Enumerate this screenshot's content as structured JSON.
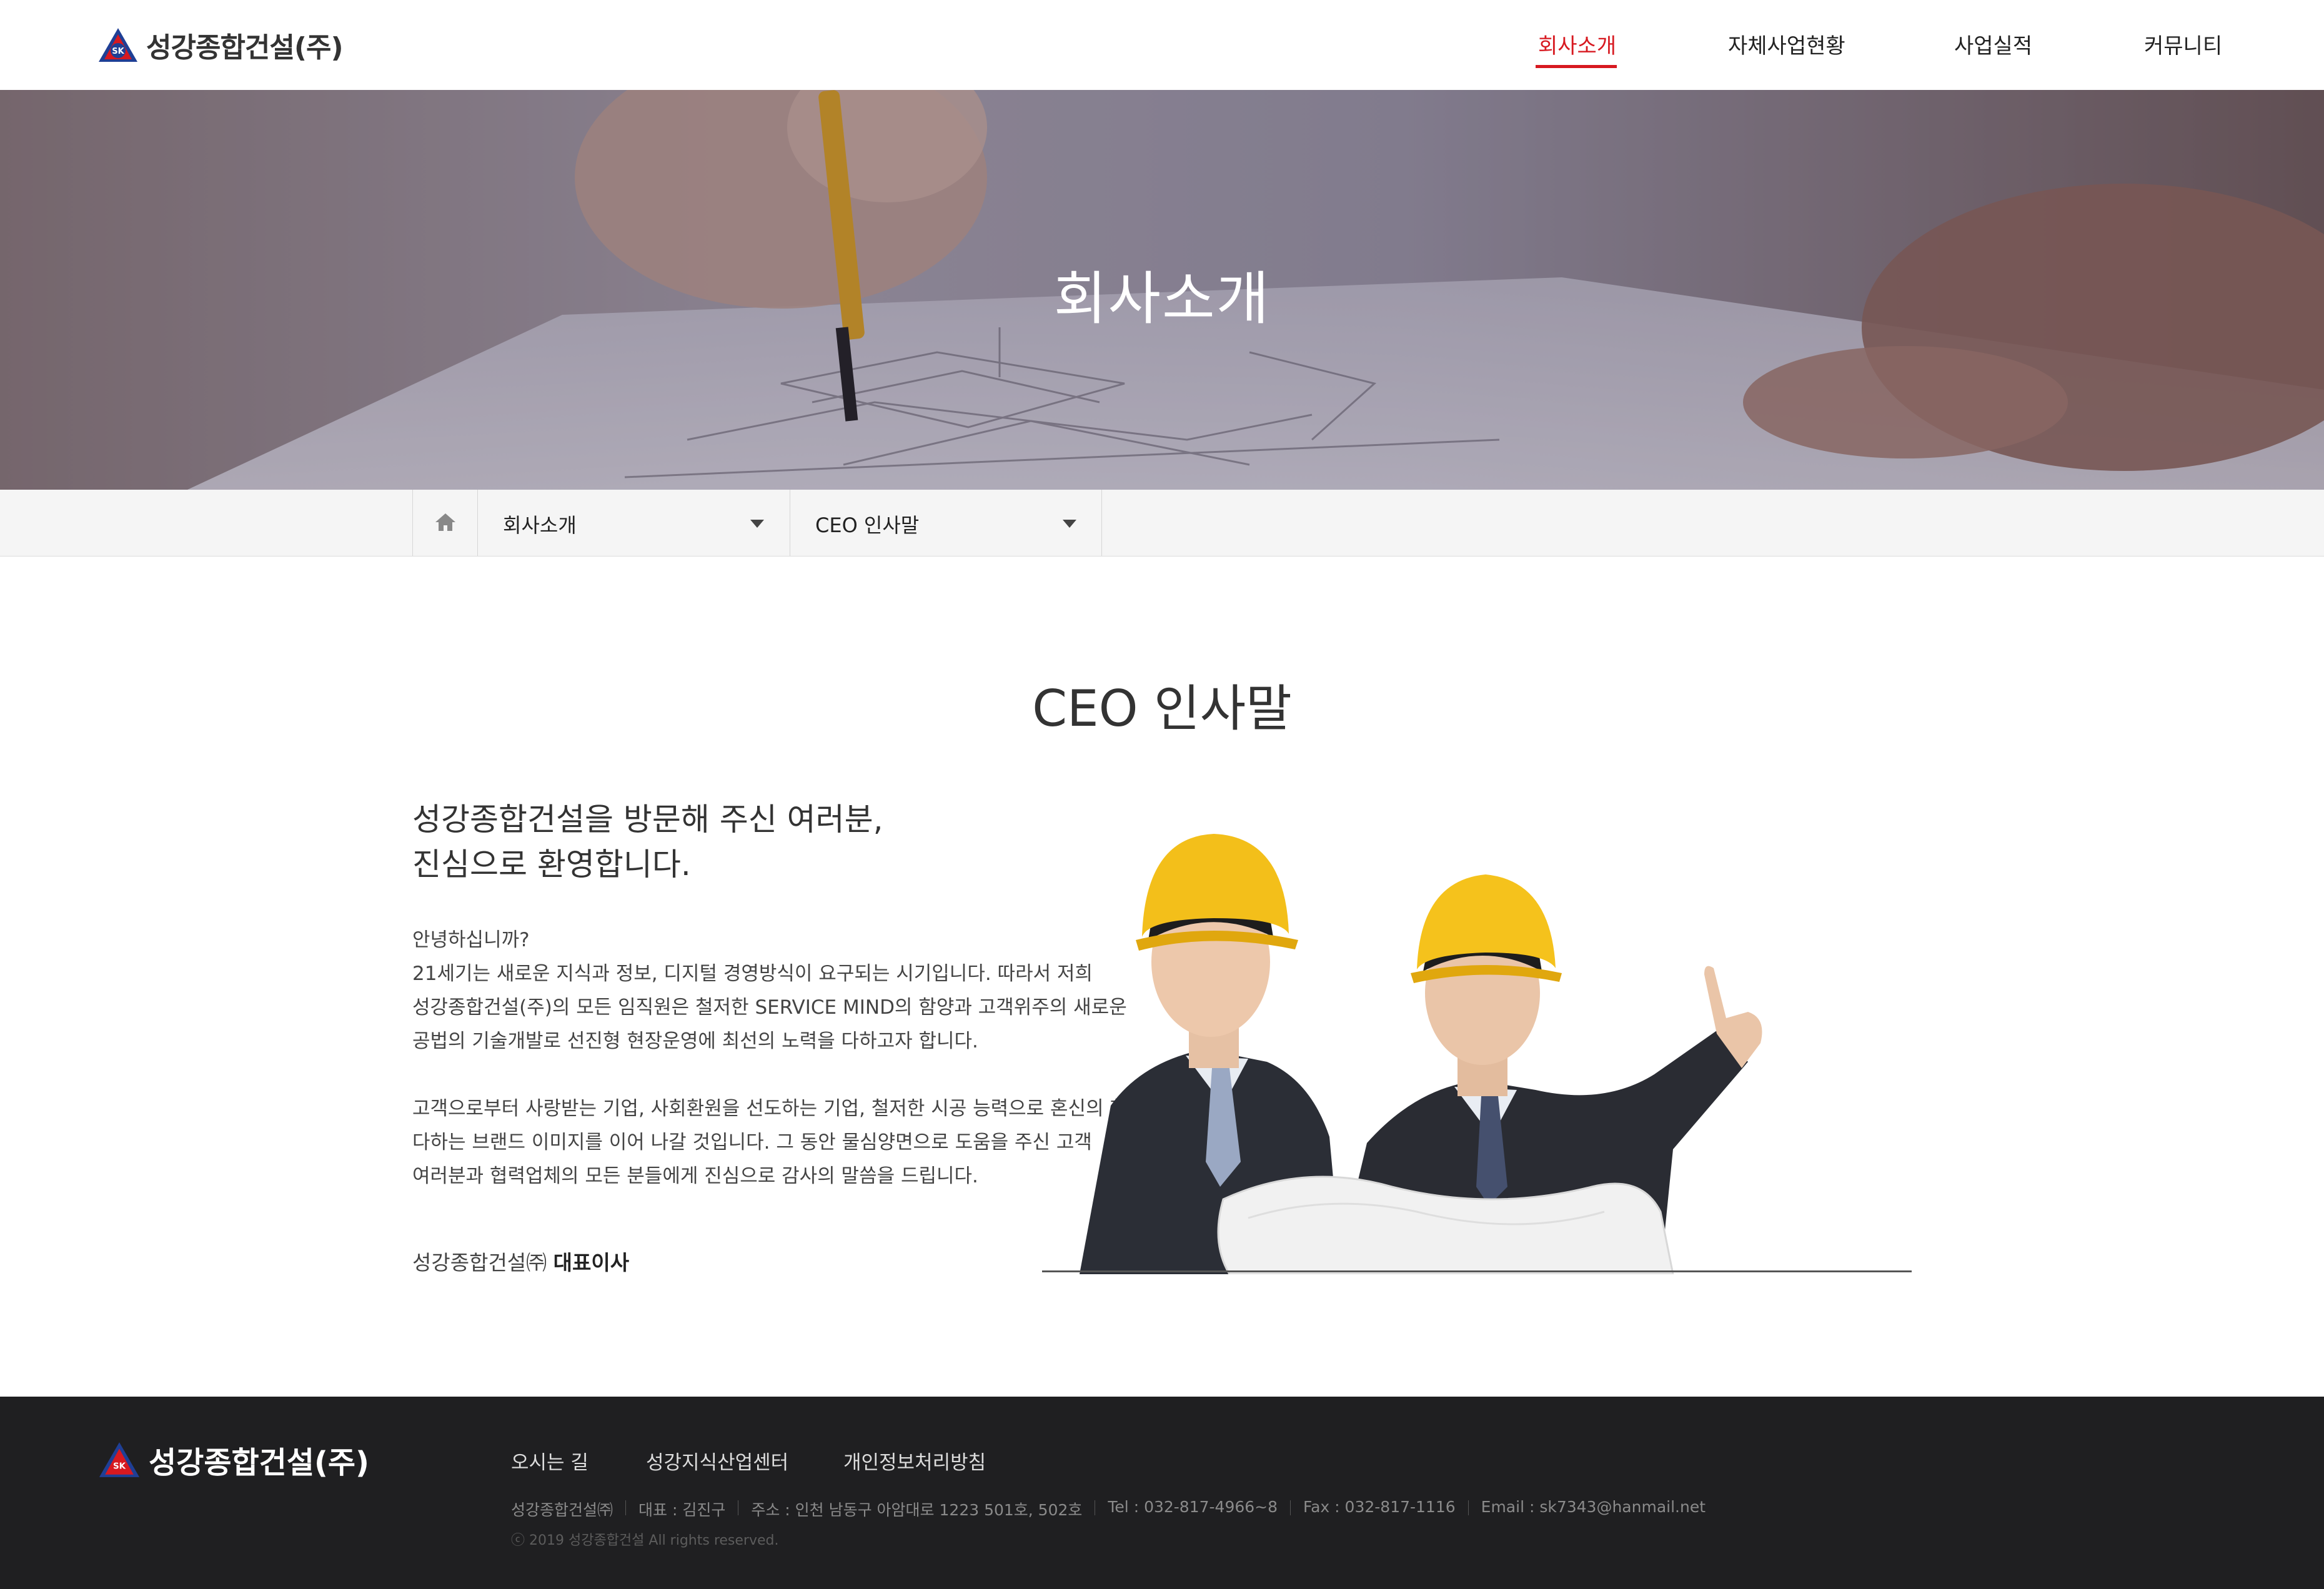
{
  "header": {
    "logo_text": "성강종합건설(주)",
    "nav": [
      {
        "label": "회사소개",
        "active": true
      },
      {
        "label": "자체사업현황",
        "active": false
      },
      {
        "label": "사업실적",
        "active": false
      },
      {
        "label": "커뮤니티",
        "active": false
      }
    ]
  },
  "hero": {
    "title": "회사소개"
  },
  "breadcrumb": {
    "home_icon": "home-icon",
    "level1": "회사소개",
    "level2": "CEO 인사말"
  },
  "main": {
    "title": "CEO 인사말",
    "greeting_lines": [
      "성강종합건설을 방문해 주신 여러분,",
      "진심으로 환영합니다."
    ],
    "paragraph1": [
      "안녕하십니까?",
      "21세기는 새로운 지식과 정보, 디지털 경영방식이 요구되는 시기입니다. 따라서 저희",
      "성강종합건설(주)의 모든 임직원은 철저한 SERVICE MIND의 함양과 고객위주의 새로운",
      "공법의 기술개발로 선진형 현장운영에 최선의 노력을 다하고자 합니다."
    ],
    "paragraph2": [
      "고객으로부터 사랑받는 기업, 사회환원을 선도하는 기업, 철저한 시공 능력으로 혼신의 힘을",
      "다하는 브랜드 이미지를 이어 나갈 것입니다. 그 동안 물심양면으로 도움을 주신 고객",
      "여러분과 협력업체의 모든 분들에게 진심으로 감사의 말씀을 드립니다."
    ],
    "signature_company": "성강종합건설㈜",
    "signature_title": "대표이사"
  },
  "footer": {
    "logo_text": "성강종합건설(주)",
    "links": [
      "오시는 길",
      "성강지식산업센터",
      "개인정보처리방침"
    ],
    "info": [
      "성강종합건설㈜",
      "대표 : 김진구",
      "주소 : 인천 남동구 아암대로 1223 501호, 502호",
      "Tel : 032-817-4966~8",
      "Fax : 032-817-1116",
      "Email : sk7343@hanmail.net"
    ],
    "copyright": "ⓒ 2019 성강종합건설 All rights reserved."
  },
  "colors": {
    "accent": "#d71920",
    "footer_bg": "#1f1f21",
    "crumb_bg": "#f5f5f5"
  }
}
